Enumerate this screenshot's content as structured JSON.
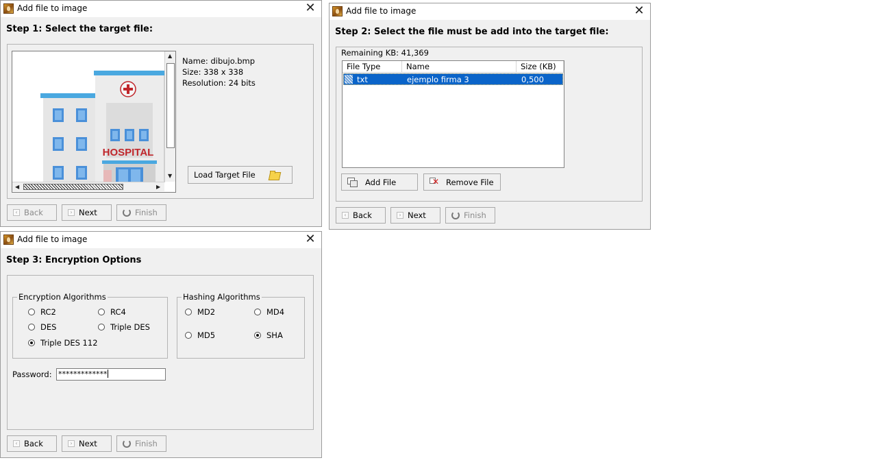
{
  "colors": {
    "selection": "#0a64c9",
    "window_bg": "#f0f0f0",
    "hospital_text": "#c0262b",
    "building_blue": "#4a90d9"
  },
  "windows": {
    "step1": {
      "title": "Add file to image",
      "step": "Step 1: Select the target file:",
      "preview_label": "HOSPITAL",
      "info": {
        "name": "Name: dibujo.bmp",
        "size": "Size: 338 x 338",
        "resolution": "Resolution: 24 bits"
      },
      "load_button": "Load Target File",
      "buttons": {
        "back": "Back",
        "next": "Next",
        "finish": "Finish"
      }
    },
    "step2": {
      "title": "Add file to image",
      "step": "Step 2: Select the file must be add into the target file:",
      "remaining": "Remaining KB: 41,369",
      "columns": [
        "File Type",
        "Name",
        "Size (KB)"
      ],
      "rows": [
        {
          "type": "txt",
          "name": "ejemplo firma 3",
          "size": "0,500"
        }
      ],
      "add_button": "Add File",
      "remove_button": "Remove File",
      "buttons": {
        "back": "Back",
        "next": "Next",
        "finish": "Finish"
      }
    },
    "step3": {
      "title": "Add file to image",
      "step": "Step 3: Encryption Options",
      "encryption_legend": "Encryption Algorithms",
      "encryption": [
        {
          "label": "RC2",
          "selected": false
        },
        {
          "label": "RC4",
          "selected": false
        },
        {
          "label": "DES",
          "selected": false
        },
        {
          "label": "Triple DES",
          "selected": false
        },
        {
          "label": "Triple DES 112",
          "selected": true
        }
      ],
      "hashing_legend": "Hashing Algorithms",
      "hashing": [
        {
          "label": "MD2",
          "selected": false
        },
        {
          "label": "MD4",
          "selected": false
        },
        {
          "label": "MD5",
          "selected": false
        },
        {
          "label": "SHA",
          "selected": true
        }
      ],
      "password_label": "Password:",
      "password_value": "*************",
      "buttons": {
        "back": "Back",
        "next": "Next",
        "finish": "Finish"
      }
    }
  }
}
